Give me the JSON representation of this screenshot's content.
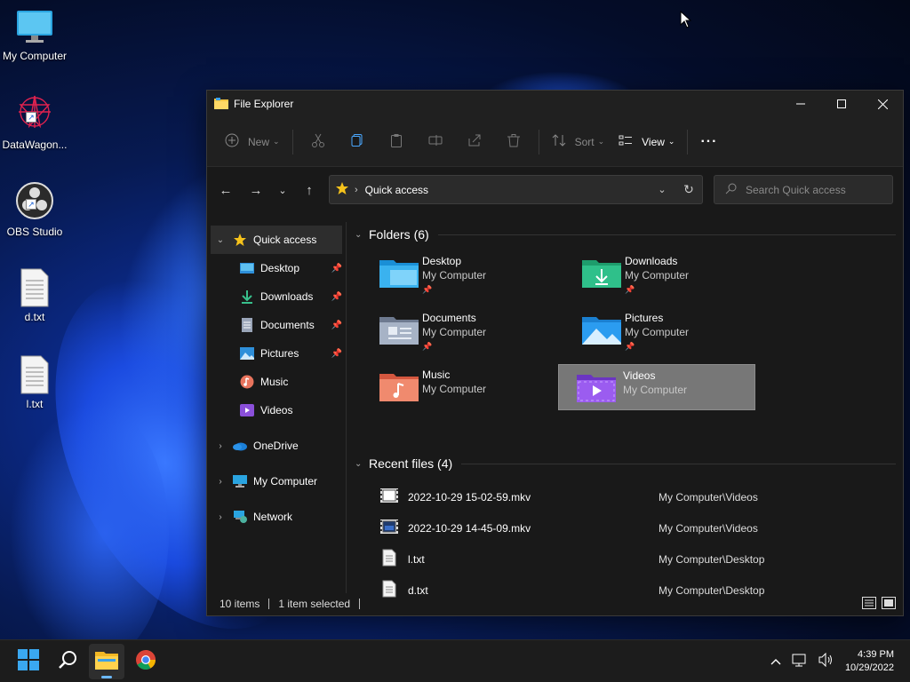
{
  "desktop": {
    "icons": [
      {
        "label": "My Computer",
        "icon": "monitor-icon"
      },
      {
        "label": "DataWagon...",
        "icon": "datawagon-icon"
      },
      {
        "label": "OBS Studio",
        "icon": "obs-icon"
      },
      {
        "label": "d.txt",
        "icon": "text-file-icon"
      },
      {
        "label": "l.txt",
        "icon": "text-file-icon"
      }
    ]
  },
  "window": {
    "title": "File Explorer",
    "toolbar": {
      "new_label": "New",
      "sort_label": "Sort",
      "view_label": "View",
      "more_label": "···"
    },
    "address": {
      "crumb": "Quick access",
      "separator": "›"
    },
    "search": {
      "placeholder": "Search Quick access"
    },
    "sidebar": {
      "quick_access": "Quick access",
      "pinned": [
        {
          "label": "Desktop",
          "pinned": true
        },
        {
          "label": "Downloads",
          "pinned": true
        },
        {
          "label": "Documents",
          "pinned": true
        },
        {
          "label": "Pictures",
          "pinned": true
        },
        {
          "label": "Music",
          "pinned": false
        },
        {
          "label": "Videos",
          "pinned": false
        }
      ],
      "roots": [
        {
          "label": "OneDrive"
        },
        {
          "label": "My Computer"
        },
        {
          "label": "Network"
        }
      ]
    },
    "folders_heading": "Folders (6)",
    "folders": [
      {
        "name": "Desktop",
        "location": "My Computer",
        "pinned": true
      },
      {
        "name": "Downloads",
        "location": "My Computer",
        "pinned": true
      },
      {
        "name": "Documents",
        "location": "My Computer",
        "pinned": true
      },
      {
        "name": "Pictures",
        "location": "My Computer",
        "pinned": true
      },
      {
        "name": "Music",
        "location": "My Computer",
        "pinned": false
      },
      {
        "name": "Videos",
        "location": "My Computer",
        "pinned": false,
        "selected": true
      }
    ],
    "recent_heading": "Recent files (4)",
    "recent": [
      {
        "name": "2022-10-29 15-02-59.mkv",
        "location": "My Computer\\Videos"
      },
      {
        "name": "2022-10-29 14-45-09.mkv",
        "location": "My Computer\\Videos"
      },
      {
        "name": "l.txt",
        "location": "My Computer\\Desktop"
      },
      {
        "name": "d.txt",
        "location": "My Computer\\Desktop"
      }
    ],
    "status": {
      "items": "10 items",
      "selected": "1 item selected"
    }
  },
  "taskbar": {
    "time": "4:39 PM",
    "date": "10/29/2022"
  },
  "colors": {
    "accent": "#6cb8ff",
    "window_bg": "#191919",
    "selected_card": "#777777"
  }
}
